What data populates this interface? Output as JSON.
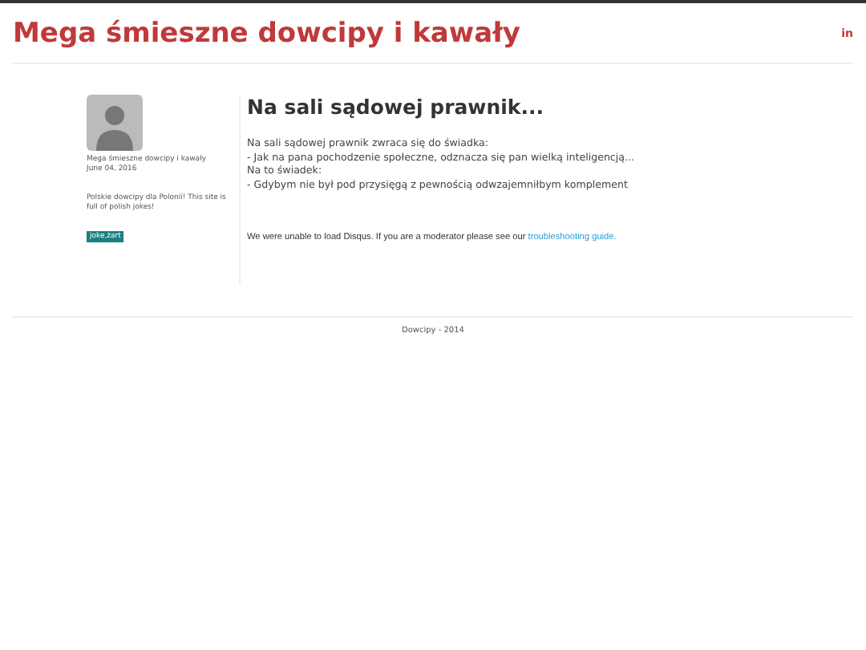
{
  "header": {
    "title": "Mega śmieszne dowcipy i kawały",
    "social_link": "in"
  },
  "sidebar": {
    "author": "Mega śmieszne dowcipy i kawały",
    "date": "June 04, 2016",
    "description": "Polskie dowcipy dla Polonii! This site is full of polish jokes!",
    "tags": [
      "joke,żart"
    ]
  },
  "post": {
    "title": "Na sali sądowej prawnik...",
    "lines": [
      "Na sali sądowej prawnik zwraca się do świadka:",
      "- Jak na pana pochodzenie społeczne, odznacza się pan wielką inteligencją...",
      "Na to świadek:",
      "- Gdybym nie był pod przysięgą z pewnością odwzajemniłbym komplement"
    ],
    "comments_notice": "We were unable to load Disqus. If you are a moderator please see our",
    "comments_link": "troubleshooting guide."
  },
  "footer": "Dowcipy - 2014"
}
